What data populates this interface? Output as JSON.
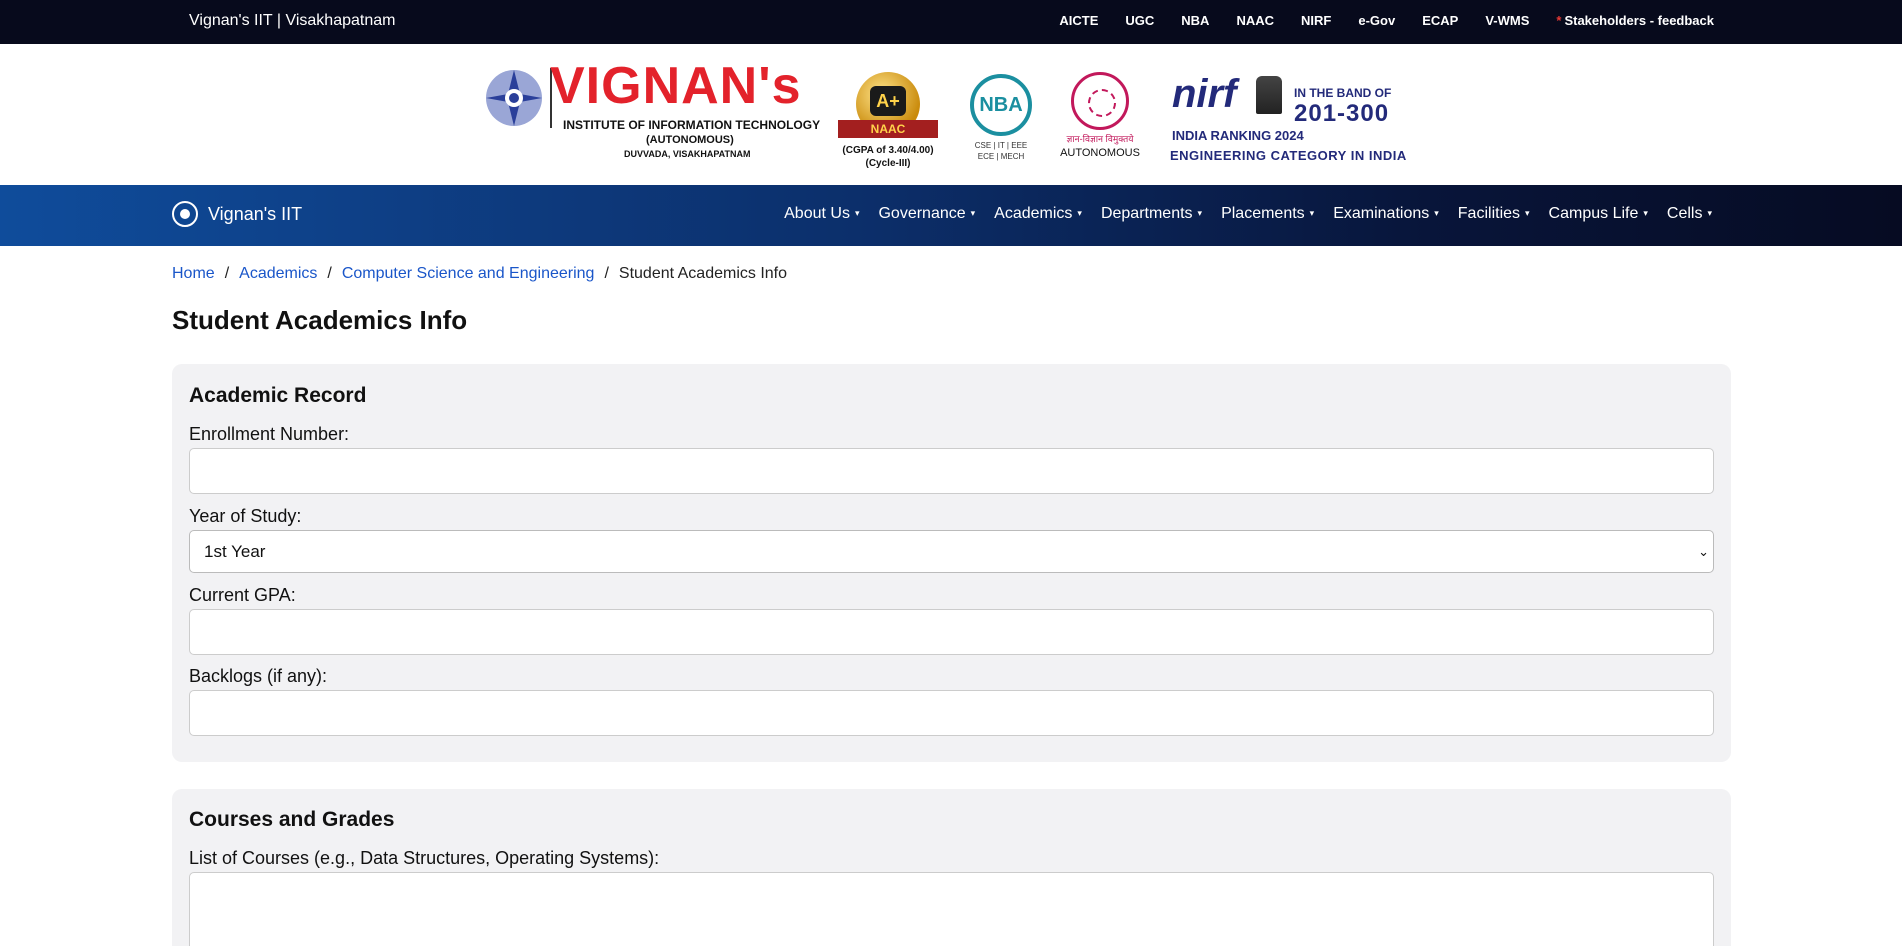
{
  "topbar": {
    "site_title": "Vignan's IIT | Visakhapatnam",
    "links": [
      "AICTE",
      "UGC",
      "NBA",
      "NAAC",
      "NIRF",
      "e-Gov",
      "ECAP",
      "V-WMS"
    ],
    "stakeholders_star": "*",
    "stakeholders": "Stakeholders - feedback"
  },
  "banner": {
    "name": "VIGNAN's",
    "institute": "INSTITUTE OF INFORMATION TECHNOLOGY",
    "autonomous": "(AUTONOMOUS)",
    "location": "DUVVADA, VISAKHAPATNAM",
    "naac_grade": "A+",
    "naac_label": "NAAC",
    "naac_cgpa": "(CGPA of 3.40/4.00)",
    "naac_cycle": "(Cycle-III)",
    "nba_logo": "NBA",
    "nba_branches_1": "CSE | IT | EEE",
    "nba_branches_2": "ECE | MECH",
    "ugc_hindi": "ज्ञान-विज्ञान विमुक्तये",
    "ugc_autonomous": "AUTONOMOUS",
    "nirf_logo": "nirf",
    "nirf_band": "IN THE BAND OF",
    "nirf_range": "201-300",
    "nirf_ranking": "INDIA RANKING 2024",
    "nirf_category": "ENGINEERING CATEGORY IN INDIA"
  },
  "nav": {
    "brand": "Vignan's IIT",
    "items": [
      "About Us",
      "Governance",
      "Academics",
      "Departments",
      "Placements",
      "Examinations",
      "Facilities",
      "Campus Life",
      "Cells"
    ],
    "caret": "▾"
  },
  "breadcrumb": {
    "home": "Home",
    "academics": "Academics",
    "department": "Computer Science and Engineering",
    "current": "Student Academics Info",
    "separator": "/"
  },
  "page_title": "Student Academics Info",
  "academic_record": {
    "heading": "Academic Record",
    "enrollment_label": "Enrollment Number:",
    "enrollment_value": "",
    "year_label": "Year of Study:",
    "year_selected": "1st Year",
    "gpa_label": "Current GPA:",
    "gpa_value": "",
    "backlogs_label": "Backlogs (if any):",
    "backlogs_value": ""
  },
  "courses": {
    "heading": "Courses and Grades",
    "list_label": "List of Courses (e.g., Data Structures, Operating Systems):",
    "list_value": ""
  }
}
